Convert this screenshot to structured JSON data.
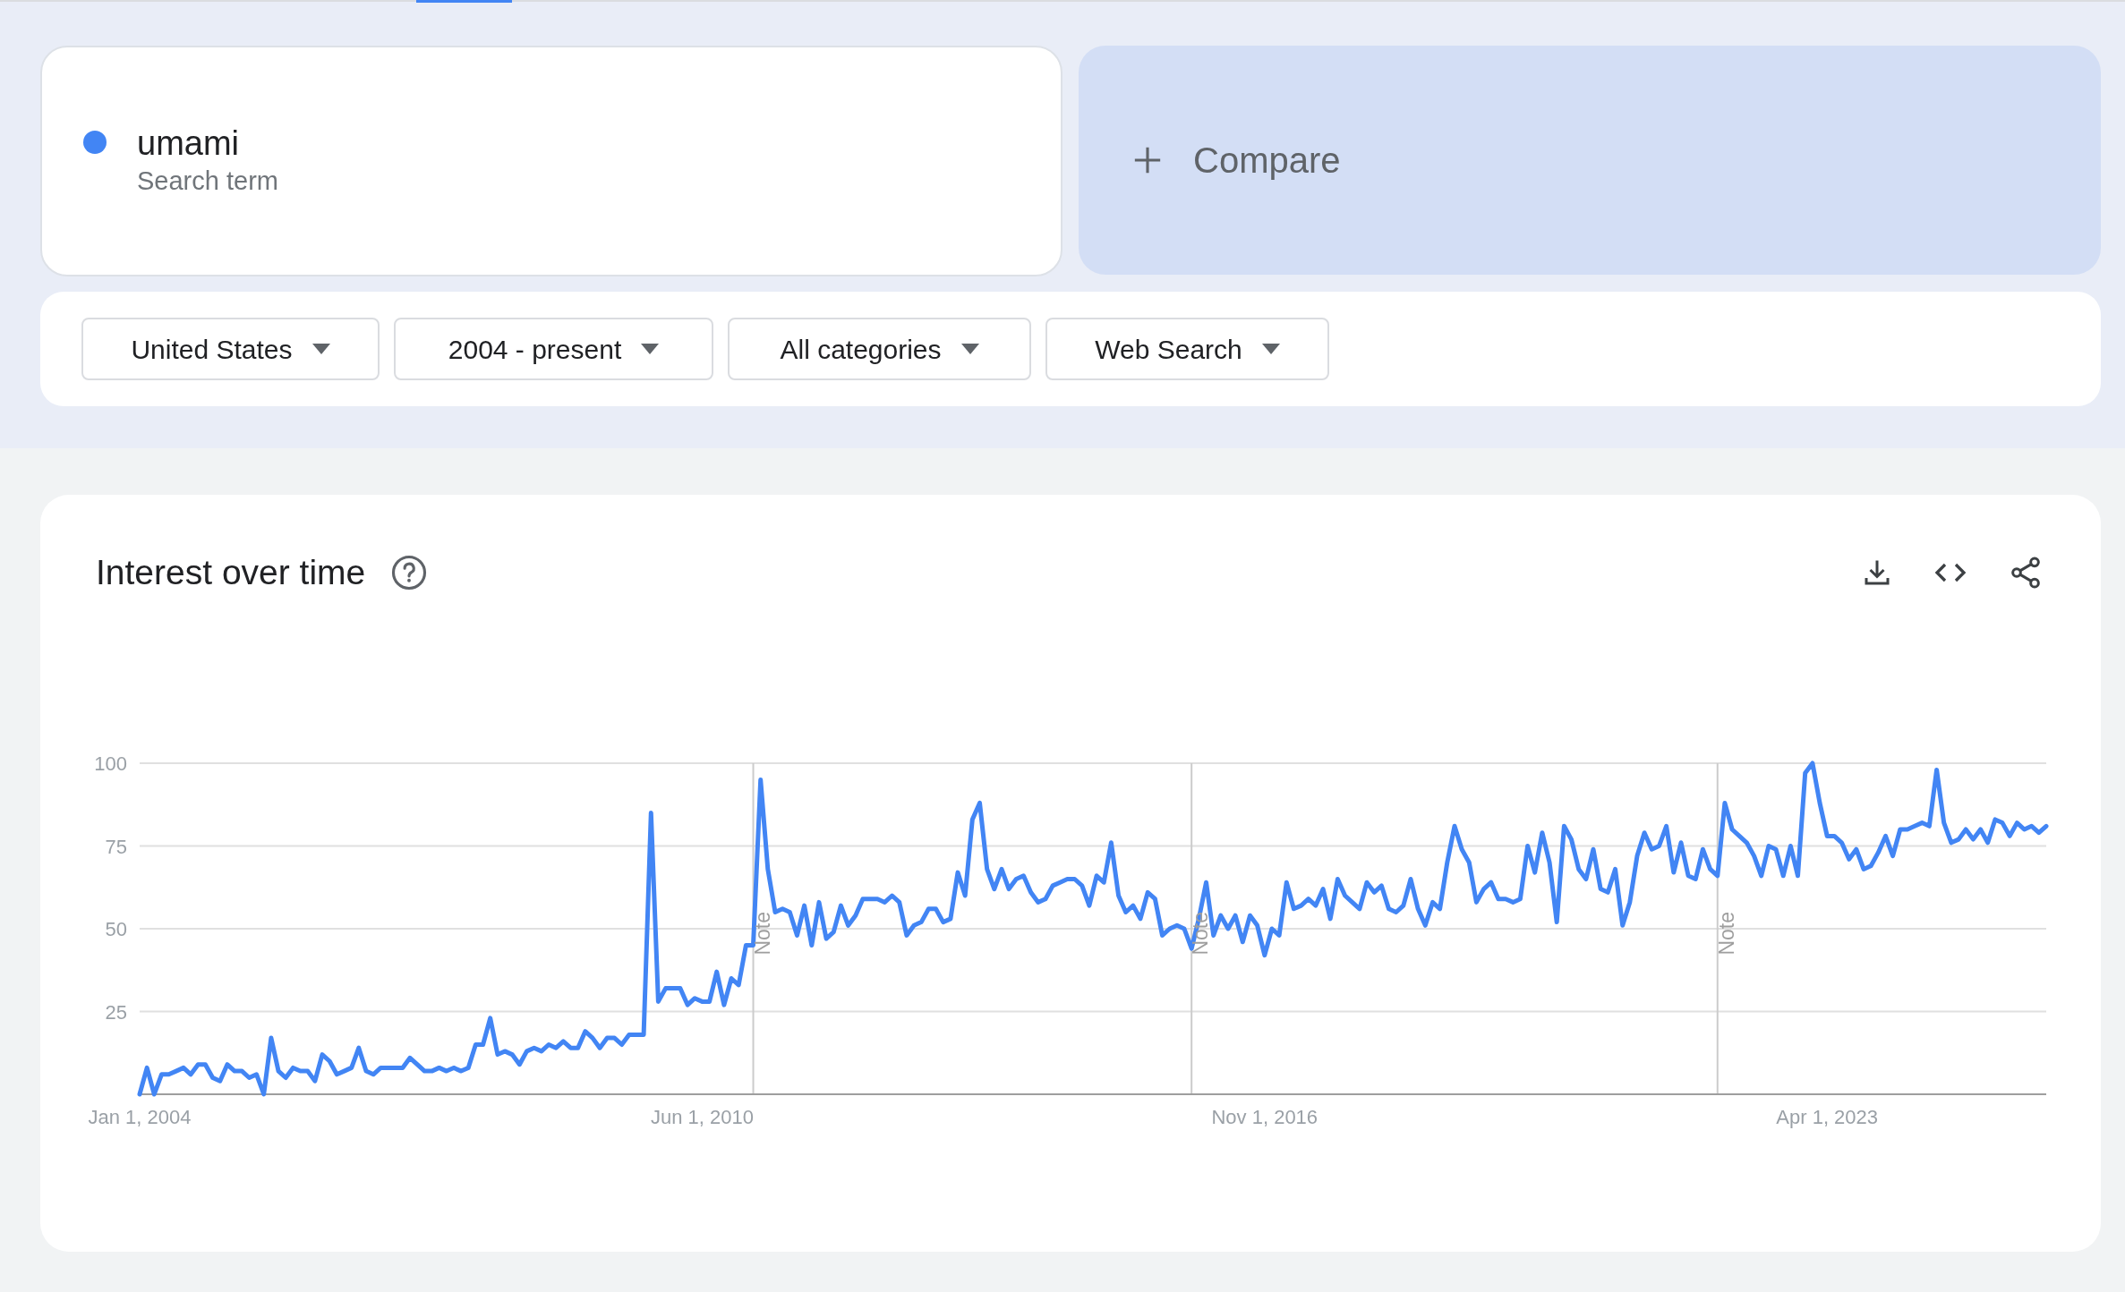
{
  "search_terms": [
    {
      "term": "umami",
      "subtitle": "Search term",
      "color": "#4285f4"
    }
  ],
  "compare": {
    "label": "Compare"
  },
  "filters": [
    {
      "label": "United States"
    },
    {
      "label": "2004 - present"
    },
    {
      "label": "All categories"
    },
    {
      "label": "Web Search"
    }
  ],
  "interest_over_time": {
    "title": "Interest over time",
    "chart_data": {
      "type": "line",
      "ylim": [
        0,
        100
      ],
      "yticks": [
        25,
        50,
        75,
        100
      ],
      "grid": true,
      "categories": [
        "Jan 1, 2004",
        null,
        null,
        null,
        null,
        null,
        null,
        null,
        null,
        null,
        null,
        null,
        null,
        null,
        null,
        null,
        null,
        null,
        null,
        null,
        null,
        null,
        null,
        null,
        null,
        null,
        null,
        null,
        null,
        null,
        null,
        null,
        null,
        null,
        null,
        null,
        null,
        null,
        null,
        null,
        null,
        null,
        null,
        null,
        null,
        null,
        null,
        null,
        null,
        null,
        null,
        null,
        null,
        null,
        null,
        null,
        null,
        null,
        null,
        null,
        null,
        null,
        null,
        null,
        null,
        null,
        null,
        null,
        null,
        null,
        null,
        null,
        null,
        null,
        null,
        null,
        null,
        "Jun 1, 2010",
        null,
        null,
        null,
        null,
        null,
        null,
        null,
        null,
        null,
        null,
        null,
        null,
        null,
        null,
        null,
        null,
        null,
        null,
        null,
        null,
        null,
        null,
        null,
        null,
        null,
        null,
        null,
        null,
        null,
        null,
        null,
        null,
        null,
        null,
        null,
        null,
        null,
        null,
        null,
        null,
        null,
        null,
        null,
        null,
        null,
        null,
        null,
        null,
        null,
        null,
        null,
        null,
        null,
        null,
        null,
        null,
        null,
        null,
        null,
        null,
        null,
        null,
        null,
        null,
        null,
        null,
        null,
        null,
        null,
        null,
        null,
        null,
        null,
        null,
        null,
        null,
        "Nov 1, 2016",
        null,
        null,
        null,
        null,
        null,
        null,
        null,
        null,
        null,
        null,
        null,
        null,
        null,
        null,
        null,
        null,
        null,
        null,
        null,
        null,
        null,
        null,
        null,
        null,
        null,
        null,
        null,
        null,
        null,
        null,
        null,
        null,
        null,
        null,
        null,
        null,
        null,
        null,
        null,
        null,
        null,
        null,
        null,
        null,
        null,
        null,
        null,
        null,
        null,
        null,
        null,
        null,
        null,
        null,
        null,
        null,
        null,
        null,
        null,
        null,
        null,
        null,
        null,
        null,
        null,
        null,
        null,
        null,
        null,
        null,
        null,
        null,
        null,
        null,
        null,
        null,
        "Apr 1, 2023",
        null,
        null,
        null,
        null,
        null,
        null,
        null,
        null,
        null,
        null,
        null,
        null,
        null,
        null,
        null,
        null,
        null,
        null,
        null,
        null,
        null,
        null,
        null,
        null,
        null,
        null,
        null,
        null,
        null,
        null
      ],
      "annotations": [
        "Note",
        "Note",
        "Note"
      ],
      "series": [
        {
          "color": "#4285f4",
          "values": [
            0,
            8,
            0,
            6,
            6,
            7,
            8,
            6,
            9,
            9,
            5,
            4,
            9,
            7,
            7,
            5,
            6,
            0,
            17,
            7,
            5,
            8,
            7,
            7,
            4,
            12,
            10,
            6,
            7,
            8,
            14,
            7,
            6,
            8,
            8,
            8,
            8,
            11,
            9,
            7,
            7,
            8,
            7,
            8,
            7,
            8,
            15,
            15,
            23,
            12,
            13,
            12,
            9,
            13,
            14,
            13,
            15,
            14,
            16,
            14,
            14,
            19,
            17,
            14,
            17,
            17,
            15,
            18,
            18,
            18,
            85,
            28,
            32,
            32,
            32,
            27,
            29,
            28,
            28,
            37,
            27,
            35,
            33,
            45,
            45,
            95,
            68,
            55,
            56,
            55,
            48,
            57,
            45,
            58,
            47,
            49,
            57,
            51,
            54,
            59,
            59,
            59,
            58,
            60,
            58,
            48,
            51,
            52,
            56,
            56,
            52,
            53,
            67,
            60,
            83,
            88,
            68,
            62,
            68,
            62,
            65,
            66,
            61,
            58,
            59,
            63,
            64,
            65,
            65,
            63,
            57,
            66,
            64,
            76,
            60,
            55,
            57,
            53,
            61,
            59,
            48,
            50,
            51,
            50,
            44,
            53,
            64,
            48,
            54,
            50,
            54,
            46,
            54,
            51,
            42,
            50,
            48,
            64,
            56,
            57,
            59,
            57,
            62,
            53,
            65,
            60,
            58,
            56,
            64,
            61,
            63,
            56,
            55,
            57,
            65,
            56,
            51,
            58,
            56,
            70,
            81,
            74,
            70,
            58,
            62,
            64,
            59,
            59,
            58,
            59,
            75,
            67,
            79,
            70,
            52,
            81,
            77,
            68,
            65,
            74,
            62,
            61,
            68,
            51,
            58,
            72,
            79,
            74,
            75,
            81,
            67,
            76,
            66,
            65,
            74,
            68,
            66,
            88,
            80,
            78,
            76,
            72,
            66,
            75,
            74,
            66,
            75,
            66,
            97,
            100,
            88,
            78,
            78,
            76,
            71,
            74,
            68,
            69,
            73,
            78,
            72,
            80,
            80,
            81,
            82,
            81,
            98,
            82,
            76,
            77,
            80,
            77,
            80,
            76,
            83,
            82,
            78,
            82,
            80,
            81,
            79,
            81
          ]
        }
      ]
    }
  }
}
